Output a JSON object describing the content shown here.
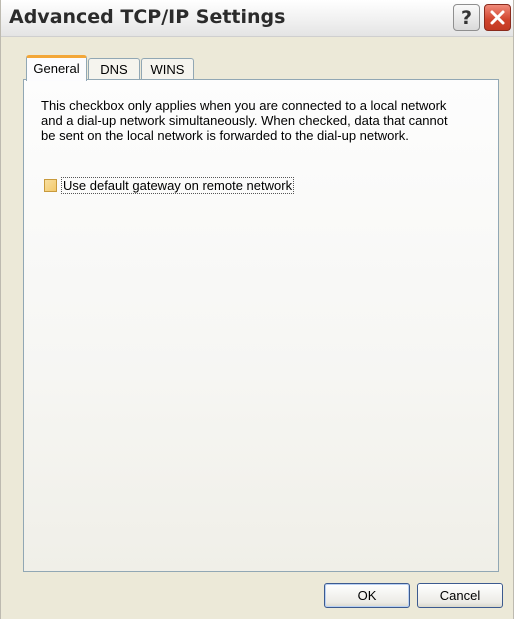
{
  "window": {
    "title": "Advanced TCP/IP Settings",
    "help_button": "?",
    "close_button_icon": "close-icon"
  },
  "tabs": [
    {
      "label": "General",
      "selected": true
    },
    {
      "label": "DNS",
      "selected": false
    },
    {
      "label": "WINS",
      "selected": false
    }
  ],
  "general": {
    "description": "This checkbox only applies when you are connected to a local network and a dial-up network simultaneously.  When checked, data that cannot be sent on the local network is forwarded to the dial-up network.",
    "gateway_checkbox": {
      "label": "Use default gateway on remote network",
      "checked": false
    }
  },
  "buttons": {
    "ok": "OK",
    "cancel": "Cancel"
  },
  "colors": {
    "tab_accent": "#f3a738",
    "close_button": "#d0432c",
    "dialog_background": "#ece9d8"
  }
}
